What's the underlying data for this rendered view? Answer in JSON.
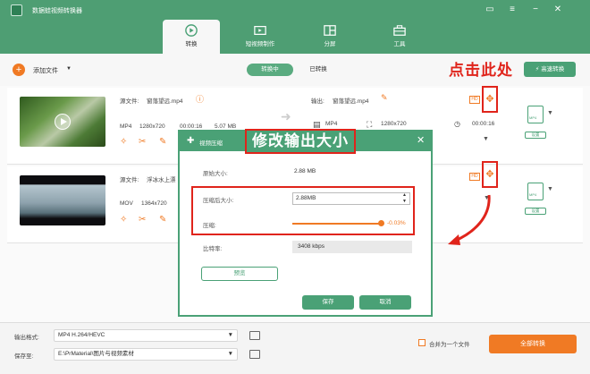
{
  "window": {
    "title": "数据蛙视频转换器",
    "controls": [
      "message-icon",
      "menu-icon",
      "minimize-icon",
      "close-icon"
    ]
  },
  "nav": {
    "tabs": [
      {
        "label": "转换",
        "icon": "convert-icon",
        "active": true
      },
      {
        "label": "短视频制作",
        "icon": "video-edit-icon",
        "active": false
      },
      {
        "label": "分屏",
        "icon": "split-screen-icon",
        "active": false
      },
      {
        "label": "工具",
        "icon": "toolbox-icon",
        "active": false
      }
    ]
  },
  "toolbar": {
    "add_file_label": "添加文件",
    "converting_label": "转换中",
    "converted_label": "已转换",
    "speed_convert_label": "高速转换"
  },
  "annotations": {
    "click_here": "点击此处",
    "modify_size": "修改输出大小"
  },
  "files": [
    {
      "source_label": "源文件:",
      "source_name": "窗落望远.mp4",
      "format": "MP4",
      "resolution": "1280x720",
      "duration": "00:00:16",
      "size": "5.07 MB",
      "output_label": "输出:",
      "output_name": "窗落望远.mp4",
      "out_format": "MP4",
      "out_resolution": "1280x720",
      "out_duration": "00:00:16",
      "fmt_sub": "设置"
    },
    {
      "source_label": "源文件:",
      "source_name": "浮冰水上漂",
      "format": "MOV",
      "resolution": "1364x720",
      "fmt_sub": "设置"
    }
  ],
  "dialog": {
    "title": "视频压缩",
    "original_size_label": "原始大小:",
    "original_size_value": "2.88 MB",
    "compressed_size_label": "压缩后大小:",
    "compressed_size_value": "2.88MB",
    "compress_label": "压缩:",
    "compress_percent": "-0.03%",
    "compress_level": 0.97,
    "bitrate_label": "比特率:",
    "bitrate_value": "3408 kbps",
    "preview_label": "预览",
    "save_label": "保存",
    "cancel_label": "取消"
  },
  "bottom": {
    "output_format_label": "输出格式:",
    "output_format_value": "MP4 H.264/HEVC",
    "save_to_label": "保存至:",
    "save_to_value": "E:\\PrMaterial\\图片与视频素材",
    "merge_label": "合并为一个文件",
    "convert_all_label": "全部转换"
  },
  "colors": {
    "brand_green": "#4aa176",
    "accent_orange": "#f07a24",
    "annotation_red": "#e0241b"
  }
}
